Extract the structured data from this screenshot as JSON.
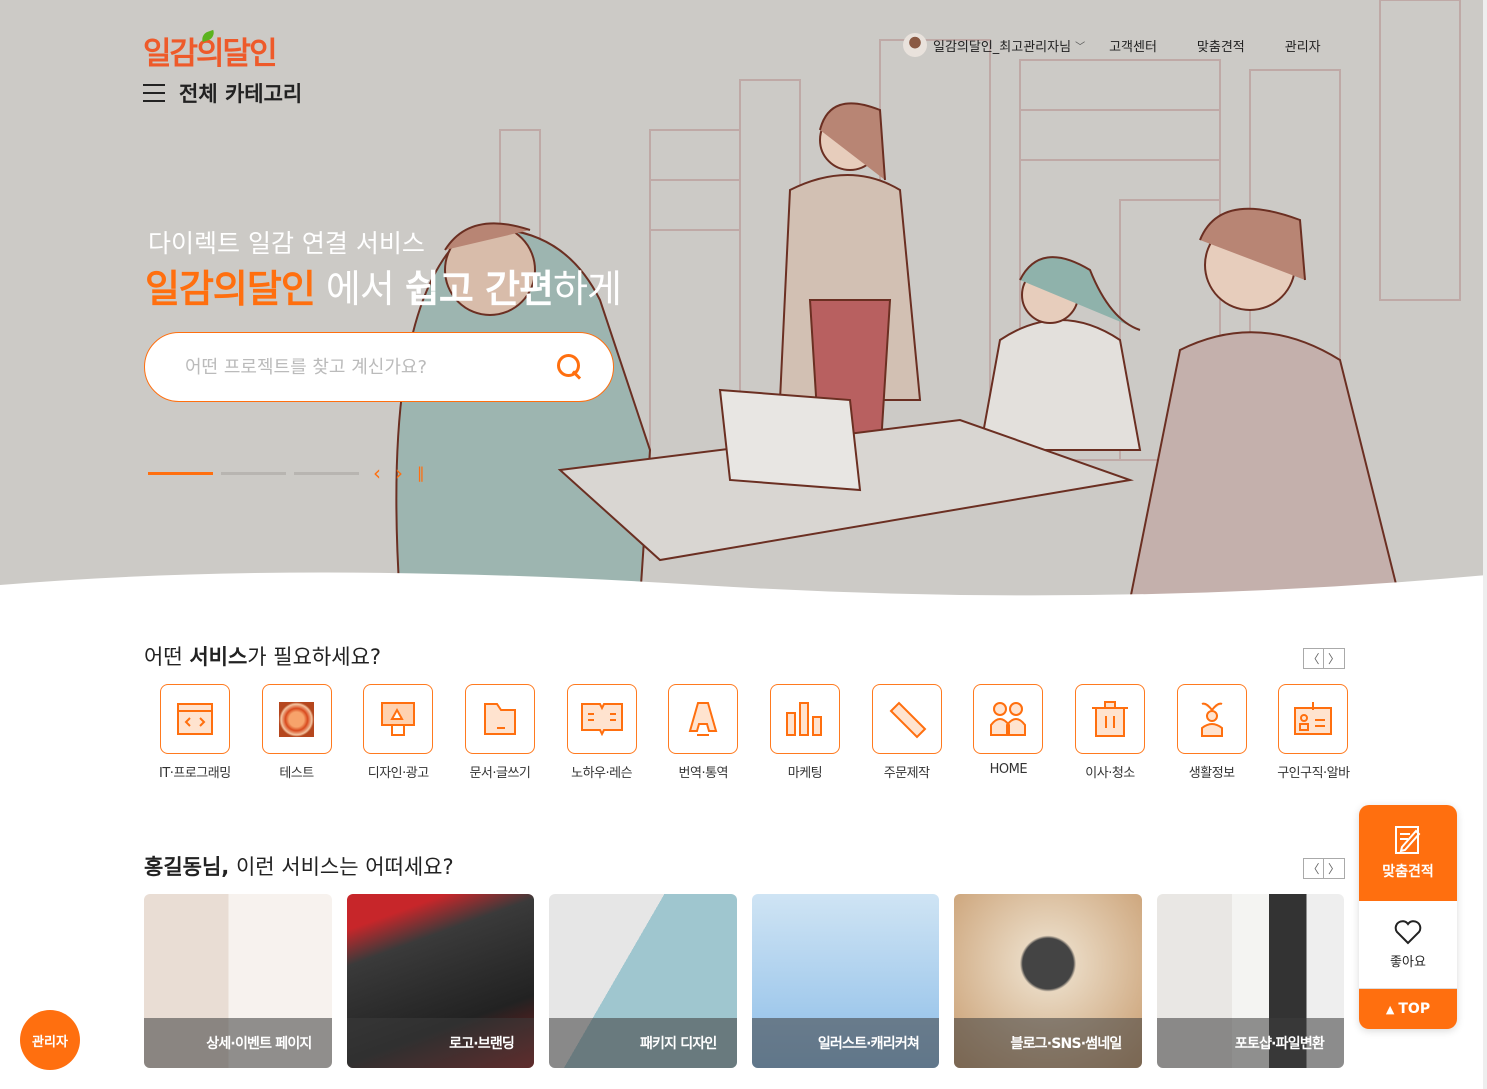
{
  "brand": {
    "logo": "일감의달인",
    "accent": "#ff6f0f",
    "logo_color": "#ee5a2a"
  },
  "header": {
    "category_label": "전체 카테고리",
    "user_name": "일감의달인_최고관리자님",
    "links": [
      "고객센터",
      "맞춤견적",
      "관리자"
    ]
  },
  "hero": {
    "subtitle": "다이렉트 일감 연결 서비스",
    "headline_brand": "일감의달인",
    "headline_mid": " 에서 ",
    "headline_bold": "쉽고 간편",
    "headline_end": "하게",
    "search_placeholder": "어떤 프로젝트를 찾고 계신가요?",
    "slides": 3,
    "active_slide": 1
  },
  "services": {
    "title_pre": "어떤 ",
    "title_bold": "서비스",
    "title_post": "가 필요하세요?",
    "items": [
      {
        "label": "IT·프로그래밍",
        "icon": "code-window-icon"
      },
      {
        "label": "테스트",
        "icon": "orange-image"
      },
      {
        "label": "디자인·광고",
        "icon": "monitor-design-icon"
      },
      {
        "label": "문서·글쓰기",
        "icon": "folder-document-icon"
      },
      {
        "label": "노하우·레슨",
        "icon": "open-book-icon"
      },
      {
        "label": "번역·통역",
        "icon": "letter-a-icon"
      },
      {
        "label": "마케팅",
        "icon": "bar-chart-icon"
      },
      {
        "label": "주문제작",
        "icon": "ruler-icon"
      },
      {
        "label": "HOME",
        "icon": "people-icon"
      },
      {
        "label": "이사·청소",
        "icon": "trash-bin-icon"
      },
      {
        "label": "생활정보",
        "icon": "person-sprout-icon"
      },
      {
        "label": "구인구직·알바",
        "icon": "id-card-icon"
      }
    ]
  },
  "recommend": {
    "title_bold": "홍길동님,",
    "title_rest": " 이런 서비스는 어떠세요?",
    "cards": [
      {
        "label": "상세·이벤트 페이지"
      },
      {
        "label": "로고·브랜딩"
      },
      {
        "label": "패키지 디자인"
      },
      {
        "label": "일러스트·캐리커쳐"
      },
      {
        "label": "블로그·SNS·썸네일"
      },
      {
        "label": "포토샵·파일변환"
      }
    ]
  },
  "quick_menu": {
    "estimate": "맞춤견적",
    "like": "좋아요",
    "top": "TOP"
  },
  "admin_button": "관리자"
}
